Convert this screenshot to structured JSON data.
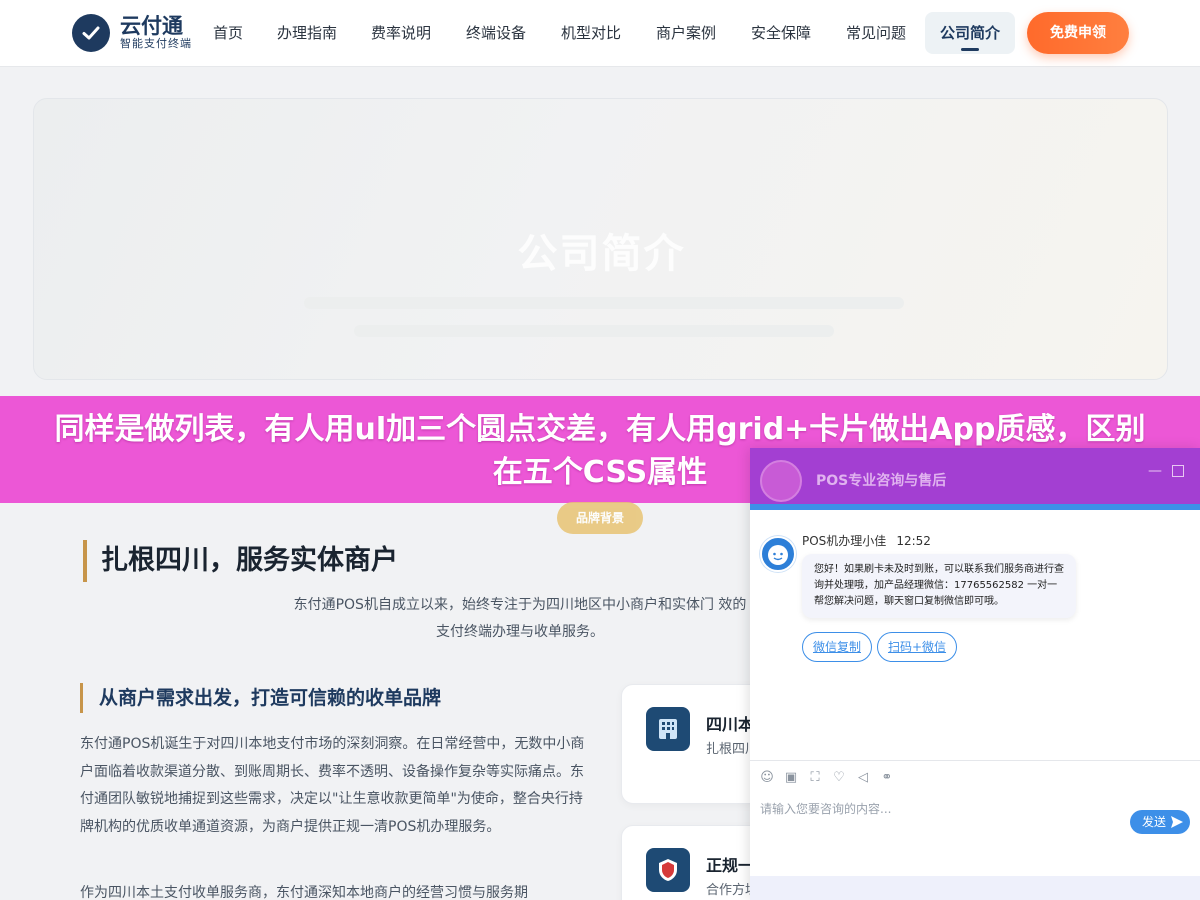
{
  "header": {
    "logo_title": "云付通",
    "logo_subtitle": "智能支付终端",
    "nav": [
      {
        "label": "首页"
      },
      {
        "label": "办理指南"
      },
      {
        "label": "费率说明"
      },
      {
        "label": "终端设备"
      },
      {
        "label": "机型对比"
      },
      {
        "label": "商户案例"
      },
      {
        "label": "安全保障"
      },
      {
        "label": "常见问题"
      },
      {
        "label": "公司简介"
      }
    ],
    "active_nav": "公司简介",
    "cta_label": "免费申领",
    "accent_color": "#1e3a5f",
    "cta_color": "#ff6a2b"
  },
  "hero": {
    "title": "公司简介"
  },
  "banner": {
    "text": "同样是做列表，有人用ul加三个圆点交差，有人用grid+卡片做出App质感，区别在五个CSS属性",
    "color": "#ec57d6"
  },
  "section": {
    "pill": "品牌背景",
    "title": "扎根四川，服务实体商户",
    "desc": "东付通POS机自成立以来，始终专注于为四川地区中小商户和实体门 效的支付终端办理与收单服务。",
    "sub_title": "从商户需求出发，打造可信赖的收单品牌",
    "para1": "东付通POS机诞生于对四川本地支付市场的深刻洞察。在日常经营中，无数中小商户面临着收款渠道分散、到账周期长、费率不透明、设备操作复杂等实际痛点。东付通团队敏锐地捕捉到这些需求，决定以\"让生意收款更简单\"为使命，整合央行持牌机构的优质收单通道资源，为商户提供正规一清POS机办理服务。",
    "para2": "作为四川本土支付收单服务商，东付通深知本地商户的经营习惯与服务期",
    "cards": [
      {
        "title": "四川本",
        "text": "扎根四川 务与技术"
      },
      {
        "title": "正规一",
        "text": "合作方垃"
      }
    ]
  },
  "chat": {
    "title": "POS专业咨询与售后",
    "agent_name": "POS机办理小佳",
    "time": "12:52",
    "message": "您好！如果刷卡未及时到账，可以联系我们服务商进行查询并处理哦，加产品经理微信：17765562582 一对一帮您解决问题，聊天窗口复制微信即可哦。",
    "quick_buttons": [
      "微信复制",
      "扫码+微信"
    ],
    "input_placeholder": "请输入您要咨询的内容...",
    "send_label": "发送",
    "header_color": "#a33fd2",
    "primary_color": "#3d8fe8"
  }
}
